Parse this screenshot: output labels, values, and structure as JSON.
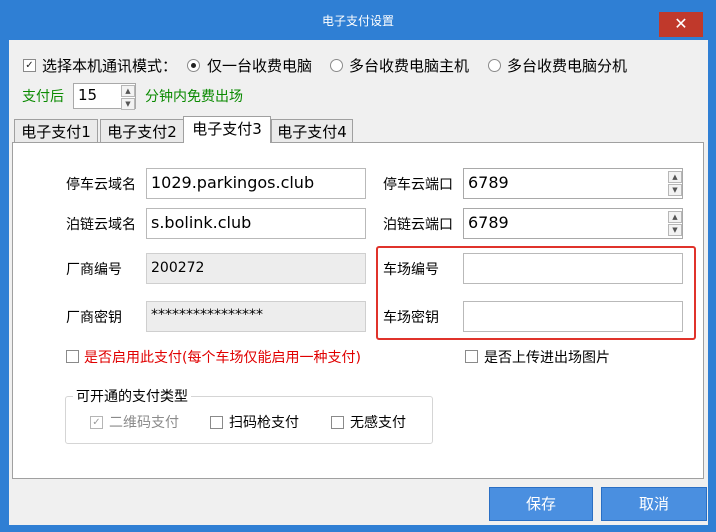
{
  "window": {
    "title": "电子支付设置",
    "close_glyph": "✕"
  },
  "mode": {
    "checkbox_checked": true,
    "label": "选择本机通讯模式：",
    "options": [
      "仅一台收费电脑",
      "多台收费电脑主机",
      "多台收费电脑分机"
    ],
    "selected_index": 0
  },
  "payment": {
    "prefix": "支付后",
    "minutes": "15",
    "suffix": "分钟内免费出场"
  },
  "tabs": [
    "电子支付1",
    "电子支付2",
    "电子支付3",
    "电子支付4"
  ],
  "active_tab": 2,
  "form": {
    "cloud_domain_label": "停车云域名",
    "cloud_domain_value": "1029.parkingos.club",
    "cloud_port_label": "停车云端口",
    "cloud_port_value": "6789",
    "bolink_domain_label": "泊链云域名",
    "bolink_domain_value": "s.bolink.club",
    "bolink_port_label": "泊链云端口",
    "bolink_port_value": "6789",
    "vendor_id_label": "厂商编号",
    "vendor_id_value": "200272",
    "lot_id_label": "车场编号",
    "lot_id_value": "",
    "vendor_key_label": "厂商密钥",
    "vendor_key_value": "****************",
    "lot_key_label": "车场密钥",
    "lot_key_value": ""
  },
  "options": {
    "enable_label": "是否启用此支付(每个车场仅能启用一种支付)",
    "upload_label": "是否上传进出场图片"
  },
  "pay_types": {
    "title": "可开通的支付类型",
    "items": [
      "二维码支付",
      "扫码枪支付",
      "无感支付"
    ]
  },
  "buttons": {
    "save": "保存",
    "cancel": "取消"
  },
  "colors": {
    "titlebar": "#2f7fd4",
    "close": "#c0392b",
    "highlight": "#e0332b",
    "green_text": "#0a8a00",
    "red_text": "#e00000"
  }
}
